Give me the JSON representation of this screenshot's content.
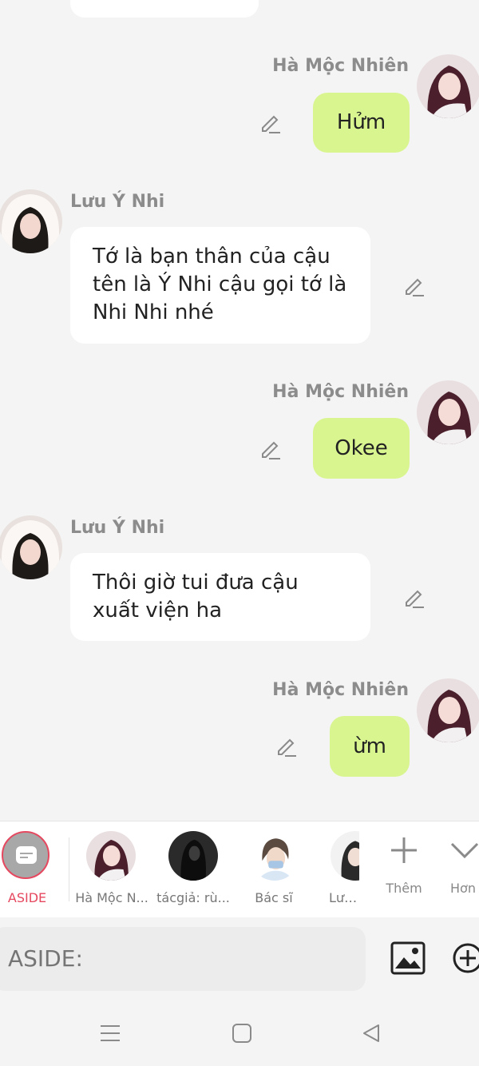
{
  "messages": [
    {
      "sender": "Hà Mộc Nhiên",
      "text": "Hửm"
    },
    {
      "sender": "Lưu Ý Nhi",
      "text": "Tớ là bạn thân của cậu tên là Ý Nhi cậu gọi tớ là Nhi Nhi nhé"
    },
    {
      "sender": "Hà Mộc Nhiên",
      "text": "Okee"
    },
    {
      "sender": "Lưu Ý Nhi",
      "text": "Thôi giờ tui đưa cậu xuất viện ha"
    },
    {
      "sender": "Hà Mộc Nhiên",
      "text": "ừm"
    }
  ],
  "tray": {
    "aside_label": "ASIDE",
    "characters": [
      {
        "label": "Hà Mộc N..."
      },
      {
        "label": "tácgiả: rù..."
      },
      {
        "label": "Bác sĩ"
      },
      {
        "label": "Lưu Ý"
      }
    ],
    "more_label": "Thêm",
    "collapse_label": "Hơn"
  },
  "composer": {
    "placeholder": "ASIDE:"
  },
  "colors": {
    "my_bubble": "#d9f590",
    "other_bubble": "#ffffff",
    "aside_accent": "#e5485f",
    "background": "#f4f4f4"
  },
  "icons": [
    "edit-pencil-icon",
    "image-icon",
    "add-circle-icon",
    "plus-icon",
    "chevron-down-icon",
    "menu-icon",
    "home-square-icon",
    "back-triangle-icon"
  ]
}
